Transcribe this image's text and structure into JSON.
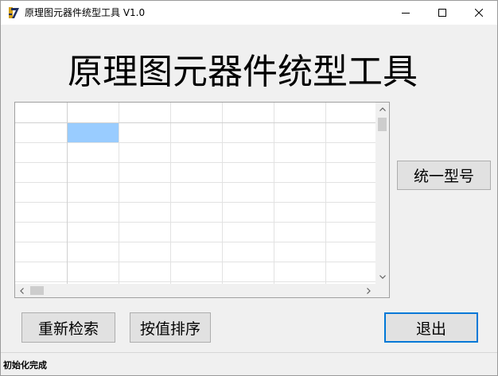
{
  "window": {
    "title": "原理图元器件统型工具 V1.0",
    "app_icon": "app-logo-icon",
    "controls": [
      "minimize-icon",
      "maximize-icon",
      "close-icon"
    ]
  },
  "main": {
    "heading": "原理图元器件统型工具"
  },
  "grid": {
    "columns": [
      "",
      "",
      "",
      "",
      "",
      "",
      ""
    ],
    "rows": [
      [
        "",
        "",
        "",
        "",
        "",
        "",
        ""
      ],
      [
        "",
        "",
        "",
        "",
        "",
        "",
        ""
      ],
      [
        "",
        "",
        "",
        "",
        "",
        "",
        ""
      ],
      [
        "",
        "",
        "",
        "",
        "",
        "",
        ""
      ],
      [
        "",
        "",
        "",
        "",
        "",
        "",
        ""
      ],
      [
        "",
        "",
        "",
        "",
        "",
        "",
        ""
      ],
      [
        "",
        "",
        "",
        "",
        "",
        "",
        ""
      ],
      [
        "",
        "",
        "",
        "",
        "",
        "",
        ""
      ]
    ],
    "selected_cell": {
      "row": 1,
      "col": 1
    },
    "selection_color": "#99ccff"
  },
  "buttons": {
    "unify_model": "统一型号",
    "re_search": "重新检索",
    "sort_by_value": "按值排序",
    "exit": "退出"
  },
  "status": {
    "text": "初始化完成"
  },
  "colors": {
    "window_bg": "#f0f0f0",
    "default_button_border": "#0078d7"
  }
}
